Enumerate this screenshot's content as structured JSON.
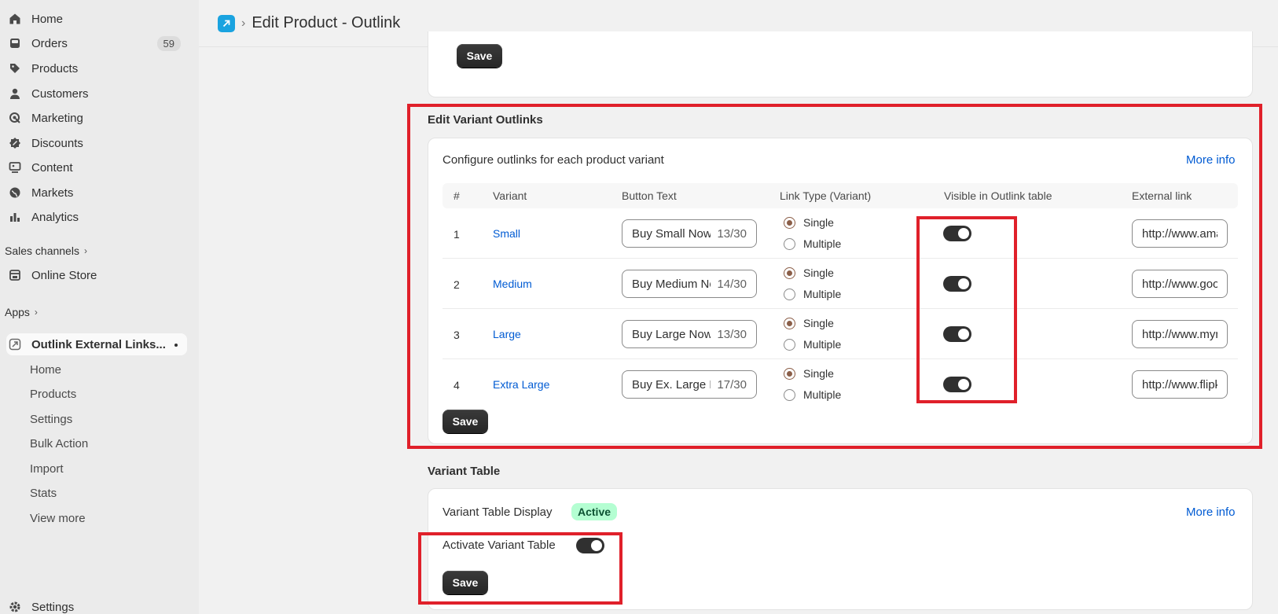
{
  "sidebar": {
    "items": [
      {
        "label": "Home",
        "icon": "home-icon"
      },
      {
        "label": "Orders",
        "icon": "orders-icon",
        "badge": "59"
      },
      {
        "label": "Products",
        "icon": "tag-icon"
      },
      {
        "label": "Customers",
        "icon": "person-icon"
      },
      {
        "label": "Marketing",
        "icon": "target-icon"
      },
      {
        "label": "Discounts",
        "icon": "discount-icon"
      },
      {
        "label": "Content",
        "icon": "content-icon"
      },
      {
        "label": "Markets",
        "icon": "globe-icon"
      },
      {
        "label": "Analytics",
        "icon": "bar-chart-icon"
      }
    ],
    "sales_channels_label": "Sales channels",
    "online_store_label": "Online Store",
    "apps_label": "Apps",
    "app_name": "Outlink External Links...",
    "app_sub_items": [
      "Home",
      "Products",
      "Settings",
      "Bulk Action",
      "Import",
      "Stats",
      "View more"
    ],
    "settings_label": "Settings"
  },
  "header": {
    "title": "Edit Product - Outlink"
  },
  "top_card": {
    "save_label": "Save"
  },
  "variant_outlinks": {
    "section_title": "Edit Variant Outlinks",
    "description": "Configure outlinks for each product variant",
    "more_info": "More info",
    "columns": [
      "#",
      "Variant",
      "Button Text",
      "Link Type (Variant)",
      "Visible in Outlink table",
      "External link"
    ],
    "radio_single": "Single",
    "radio_multiple": "Multiple",
    "rows": [
      {
        "num": "1",
        "variant": "Small",
        "button_text": "Buy Small Now",
        "count": "13/30",
        "link": "http://www.amazon.com"
      },
      {
        "num": "2",
        "variant": "Medium",
        "button_text": "Buy Medium Now",
        "count": "14/30",
        "link": "http://www.google.com"
      },
      {
        "num": "3",
        "variant": "Large",
        "button_text": "Buy Large Now",
        "count": "13/30",
        "link": "http://www.myntra.com"
      },
      {
        "num": "4",
        "variant": "Extra Large",
        "button_text": "Buy Ex. Large Now",
        "count": "17/30",
        "link": "http://www.flipkart.com"
      }
    ],
    "save_label": "Save"
  },
  "variant_table": {
    "section_title": "Variant Table",
    "display_label": "Variant Table Display",
    "status": "Active",
    "more_info": "More info",
    "activate_label": "Activate Variant Table",
    "save_label": "Save"
  },
  "colors": {
    "annotation_red": "#e0202a",
    "link_blue": "#005bd3",
    "active_green_bg": "#b4fed2"
  }
}
